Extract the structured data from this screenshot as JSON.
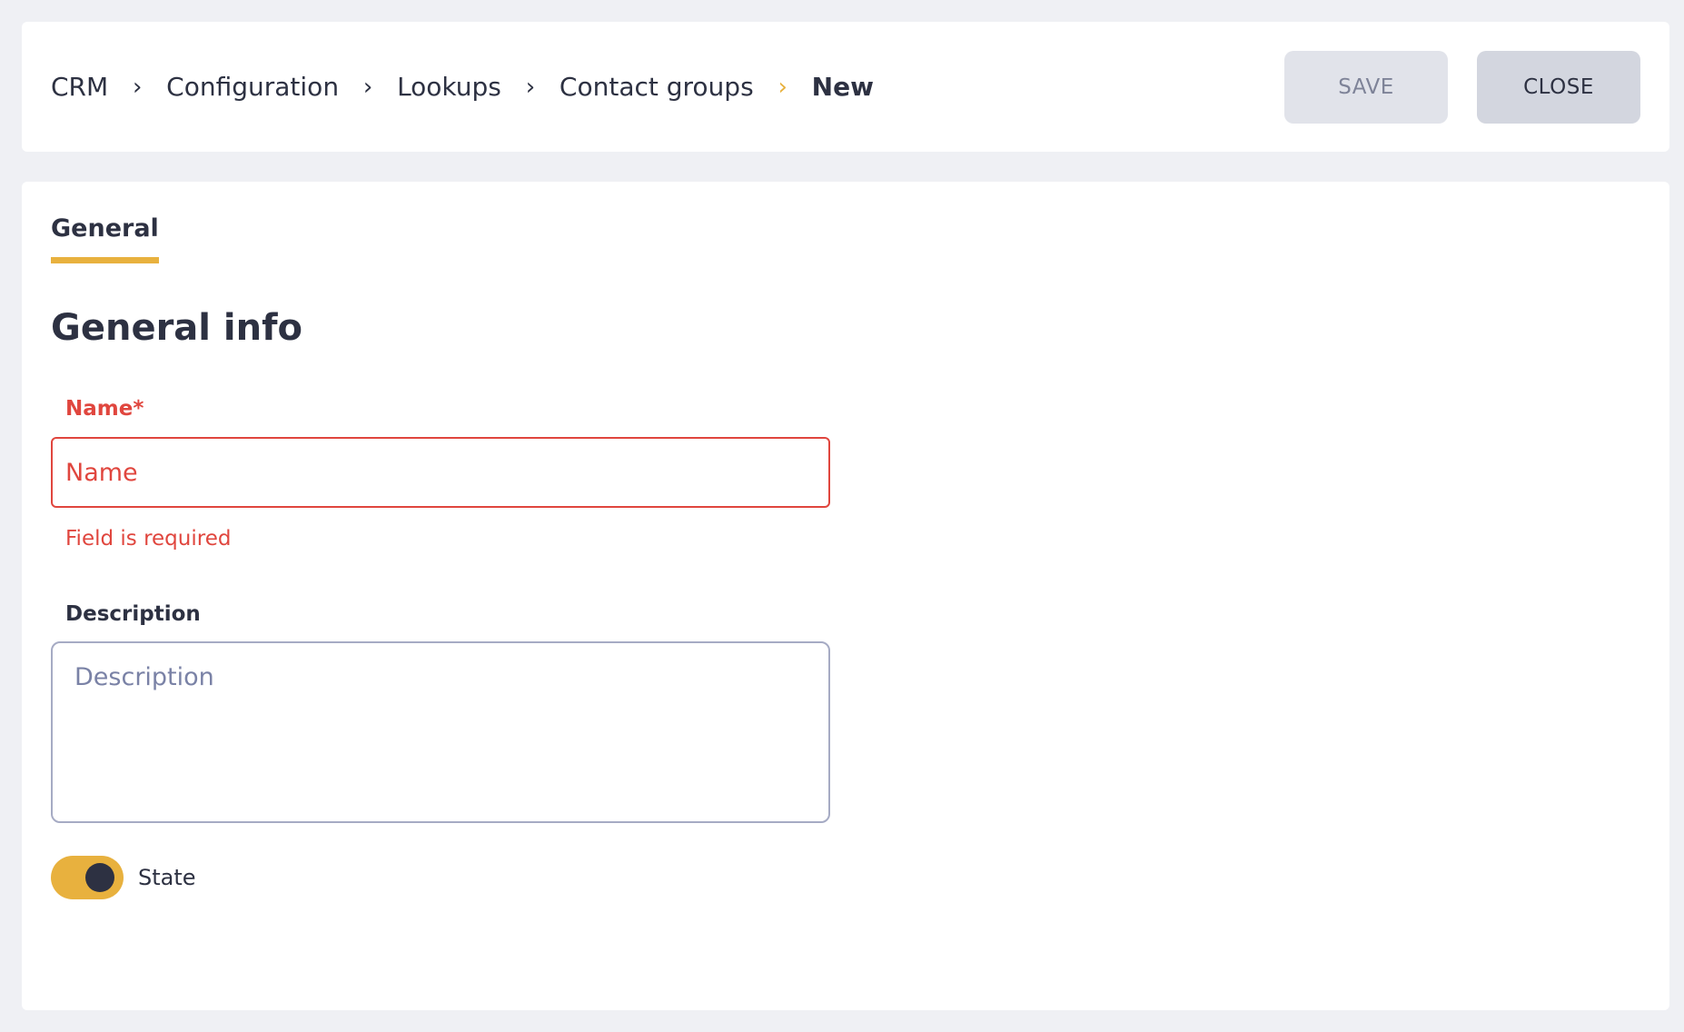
{
  "breadcrumb": {
    "items": [
      "CRM",
      "Configuration",
      "Lookups",
      "Contact groups",
      "New"
    ]
  },
  "toolbar": {
    "save_label": "SAVE",
    "close_label": "CLOSE"
  },
  "tabs": [
    {
      "label": "General",
      "active": true
    }
  ],
  "section": {
    "title": "General info"
  },
  "form": {
    "name": {
      "label": "Name*",
      "placeholder": "Name",
      "value": "",
      "error": "Field is required"
    },
    "description": {
      "label": "Description",
      "placeholder": "Description",
      "value": ""
    },
    "state": {
      "label": "State",
      "on": true
    }
  },
  "colors": {
    "accent": "#e8b13e",
    "error": "#e0463e",
    "text": "#2d3142",
    "background": "#eff0f4"
  },
  "icons": {
    "breadcrumb_separator": "chevron-right-icon"
  }
}
